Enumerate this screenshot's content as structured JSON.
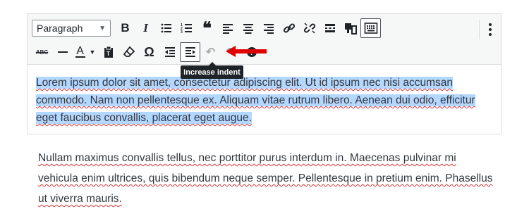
{
  "toolbar": {
    "format_select": {
      "value": "Paragraph"
    },
    "row1_buttons": [
      "bold-icon",
      "italic-icon",
      "bulleted-list-icon",
      "numbered-list-icon",
      "blockquote-icon",
      "align-left-icon",
      "align-center-icon",
      "align-right-icon",
      "insert-link-icon",
      "remove-link-icon",
      "read-more-icon",
      "toolbar-toggle-icon",
      "keyboard-shortcuts-icon",
      "more-options-icon"
    ],
    "row2_buttons": [
      "strikethrough-icon",
      "horizontal-line-icon",
      "text-color-icon",
      "paste-as-text-icon",
      "clear-formatting-icon",
      "special-character-icon",
      "decrease-indent-icon",
      "increase-indent-icon",
      "undo-icon",
      "redo-icon",
      "help-icon"
    ],
    "text_color_letter": "A",
    "special_char_symbol": "Ω"
  },
  "tooltip": {
    "text": "Increase indent"
  },
  "editor": {
    "paragraph": "Lorem ipsum dolor sit amet, consectetur adipiscing elit. Ut id ipsum nec nisi accumsan commodo. Nam non pellentesque ex. Aliquam vitae rutrum libero. Aenean dui odio, efficitur eget faucibus convallis, placerat eget augue."
  },
  "outside_text": {
    "paragraph": " Nullam maximus convallis tellus, nec porttitor purus interdum in. Maecenas pulvinar mi vehicula enim ultrices, quis bibendum neque semper. Pellentesque in pretium enim. Phasellus ut viverra mauris."
  },
  "colors": {
    "selection": "#b4d7ff",
    "arrow": "#e00000",
    "tooltip_bg": "#1d2327"
  }
}
